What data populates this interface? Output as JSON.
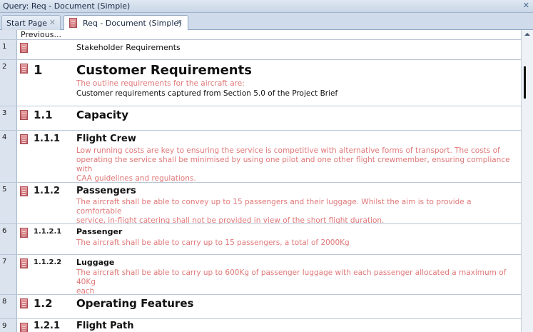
{
  "window": {
    "title": "Query: Req - Document (Simple)",
    "close": "✕"
  },
  "tabs": [
    {
      "label": "Start Page",
      "close": "✕"
    },
    {
      "label": "Req - Document (Simple)",
      "close": "✕"
    }
  ],
  "previous_label": "Previous...",
  "rows": [
    {
      "n": "1",
      "plain": "Stakeholder Requirements"
    },
    {
      "n": "2",
      "num": "1",
      "heading": "Customer Requirements",
      "lines": [
        "The outline requirements for the aircraft are:"
      ],
      "dark_line": "Customer requirements captured from Section 5.0 of the Project Brief"
    },
    {
      "n": "3",
      "num": "1.1",
      "heading": "Capacity"
    },
    {
      "n": "4",
      "num": "1.1.1",
      "heading": "Flight Crew",
      "lines": [
        "Low running costs are key to ensuring the service is competitive with alternative forms of transport.  The costs of",
        "operating the service shall be minimised by using one pilot and one other flight crewmember, ensuring compliance with",
        "CAA guidelines and regulations."
      ]
    },
    {
      "n": "5",
      "num": "1.1.2",
      "heading": "Passengers",
      "lines": [
        "The aircraft shall be able to convey up to 15 passengers and their luggage. Whilst the aim is to provide a comfortable",
        "service, in-flight catering shall not be provided in view of the short flight duration."
      ]
    },
    {
      "n": "6",
      "num": "1.1.2.1",
      "heading": "Passenger",
      "lines": [
        "The aircraft shall be able to carry up to 15 passengers, a total of 2000Kg"
      ]
    },
    {
      "n": "7",
      "num": "1.1.2.2",
      "heading": "Luggage",
      "lines": [
        "The aircraft shall be able to carry up to 600Kg of passenger luggage with each passenger allocated a maximum of 40Kg",
        "each"
      ]
    },
    {
      "n": "8",
      "num": "1.2",
      "heading": "Operating Features"
    },
    {
      "n": "9",
      "num": "1.2.1",
      "heading": "Flight Path"
    }
  ]
}
